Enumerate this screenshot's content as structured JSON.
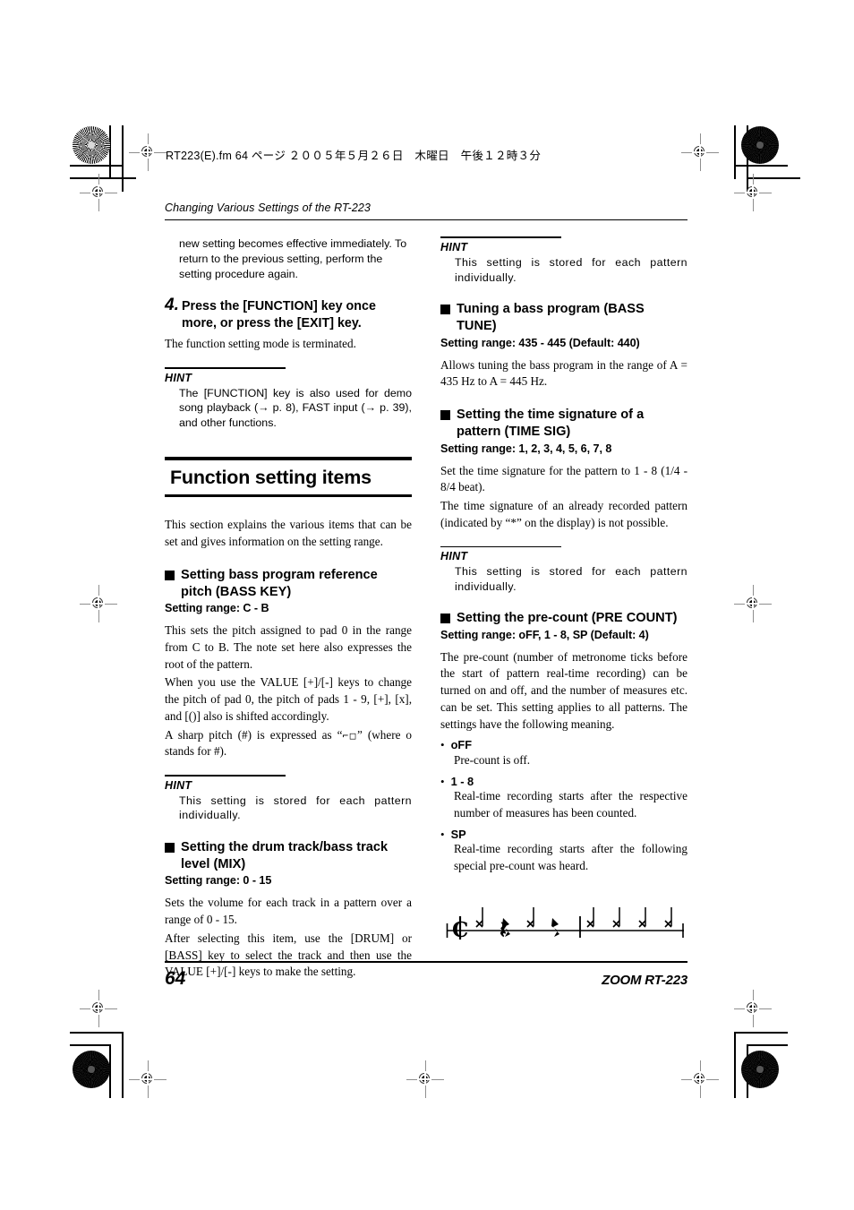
{
  "file_stamp": "RT223(E).fm  64 ページ  ２００５年５月２６日　木曜日　午後１２時３分",
  "running_head": "Changing Various Settings of the RT-223",
  "left_column": {
    "intro_paragraph": "new setting becomes effective immediately. To return to the previous setting, perform the setting procedure again.",
    "step": {
      "number": "4.",
      "text": "Press the [FUNCTION] key once more, or press the [EXIT] key."
    },
    "step_body": "The function setting mode is terminated.",
    "hint_1": {
      "label": "HINT",
      "text": "The [FUNCTION] key is also used for demo song playback (→ p. 8), FAST input (→ p. 39), and other functions."
    },
    "chapter_title": "Function setting items",
    "chapter_intro": "This section explains the various items that can be set and gives information on the setting range.",
    "section_bass_key": {
      "title": "Setting bass program reference pitch (BASS KEY)",
      "range": "Setting range: C - B",
      "para_1": "This sets the pitch assigned to pad 0 in the range from C to B. The note set here also expresses the root of the pattern.",
      "para_2": "When you use the VALUE [+]/[-] keys to change the pitch of pad 0, the pitch of pads 1 - 9, [+], [x], and [()] also is shifted accordingly.",
      "para_3_before": "A sharp pitch (#) is expressed as “",
      "para_3_glyph": "⌐□",
      "para_3_after": "” (where o stands for #)."
    },
    "hint_2": {
      "label": "HINT",
      "text": "This setting is stored for each pattern individually."
    },
    "section_mix": {
      "title": "Setting the drum track/bass track level (MIX)",
      "range": "Setting range: 0 - 15",
      "para_1": "Sets the volume for each track in a pattern over a range of 0 - 15.",
      "para_2": "After selecting this item, use the [DRUM] or [BASS] key to select the track and then use the VALUE [+]/[-] keys to make the setting."
    }
  },
  "right_column": {
    "hint_1": {
      "label": "HINT",
      "text": "This setting is stored for each pattern individually."
    },
    "section_bass_tune": {
      "title": "Tuning a bass program (BASS TUNE)",
      "range": "Setting range: 435 - 445 (Default: 440)",
      "para_1": "Allows tuning the bass program in the range of A = 435 Hz to A = 445 Hz."
    },
    "section_time_sig": {
      "title": "Setting the time signature of a pattern (TIME SIG)",
      "range": "Setting range: 1, 2, 3, 4, 5, 6, 7, 8",
      "para_1": "Set the time signature for the pattern to 1 - 8 (1/4 - 8/4 beat).",
      "para_2": "The time signature of an already recorded pattern (indicated by “*” on the display) is not possible."
    },
    "hint_2": {
      "label": "HINT",
      "text": "This setting is stored for each pattern individually."
    },
    "section_pre_count": {
      "title": "Setting the pre-count (PRE COUNT)",
      "range": "Setting range: oFF, 1 - 8, SP (Default: 4)",
      "para_1": "The pre-count (number of metronome ticks before the start of pattern real-time recording) can be turned on and off, and the number of measures etc. can be set. This setting applies to all patterns. The settings have the following meaning.",
      "bullets": [
        {
          "label": "oFF",
          "desc": "Pre-count is off."
        },
        {
          "label": "1 - 8",
          "desc": "Real-time recording starts after the respective number of measures has been counted."
        },
        {
          "label": "SP",
          "desc": "Real-time recording starts after the following special pre-count was heard."
        }
      ]
    },
    "notation": {
      "clef": "𝄵",
      "description": "special pre-count rhythm staff",
      "events": [
        "x-note",
        "rest",
        "x-note",
        "rest",
        "barline",
        "x-note",
        "x-note",
        "x-note",
        "x-note"
      ]
    }
  },
  "footer": {
    "page_number": "64",
    "brand": "ZOOM RT-223"
  },
  "colors": {
    "ink": "#000000",
    "paper": "#ffffff",
    "mark_gray": "#8e8e8e"
  }
}
